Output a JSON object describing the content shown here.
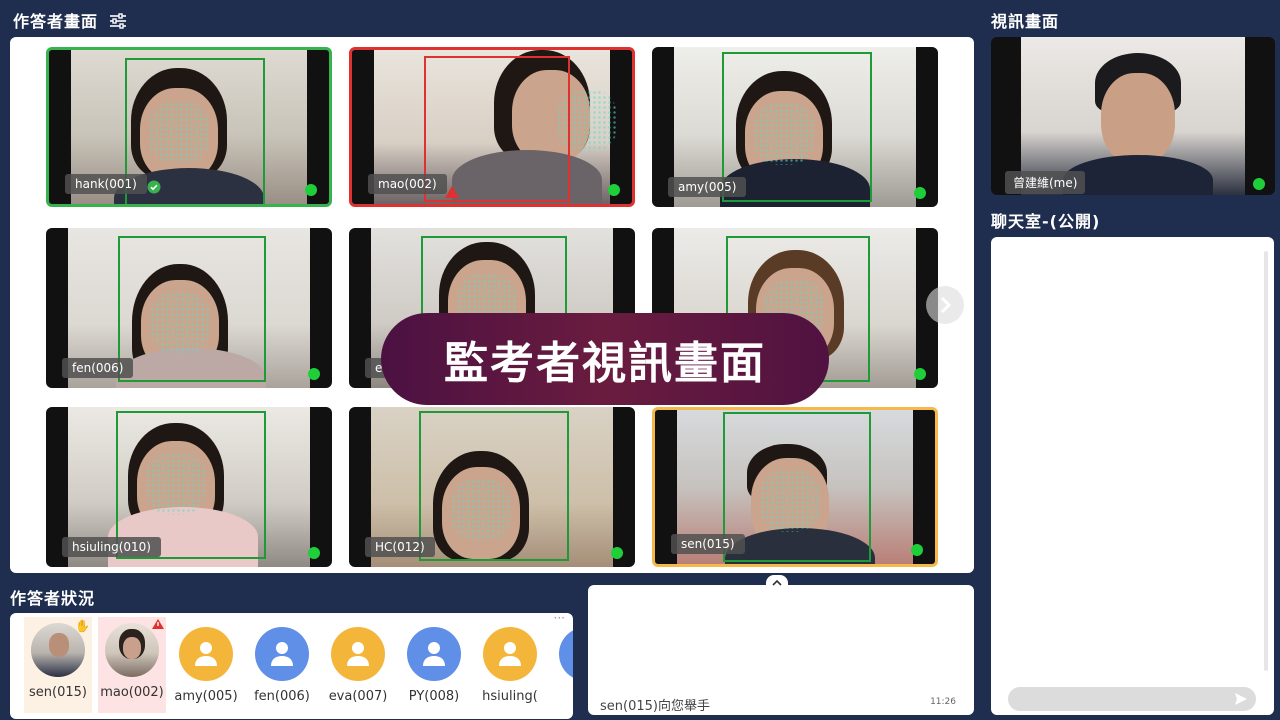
{
  "answerers_view": {
    "title": "作答者畫面",
    "filter_icon": "sliders-icon",
    "tiles": [
      {
        "name": "hank(001)",
        "status": "ok"
      },
      {
        "name": "mao(002)",
        "status": "alert"
      },
      {
        "name": "amy(005)",
        "status": "normal"
      },
      {
        "name": "fen(006)",
        "status": "normal"
      },
      {
        "name": "eva",
        "status": "normal"
      },
      {
        "name": "",
        "status": "normal"
      },
      {
        "name": "hsiuling(010)",
        "status": "normal"
      },
      {
        "name": "HC(012)",
        "status": "normal"
      },
      {
        "name": "sen(015)",
        "status": "raised-hand"
      }
    ],
    "next_icon": "chevron-right-icon"
  },
  "overlay_banner": "監考者視訊畫面",
  "video_view": {
    "title": "視訊畫面",
    "self_name": "曾建維(me)"
  },
  "chat": {
    "title": "聊天室-(公開)",
    "send_icon": "send-icon"
  },
  "status_strip": {
    "title": "作答者狀況",
    "candidates": [
      {
        "name": "sen(015)",
        "kind": "photo",
        "badge": "hand-icon"
      },
      {
        "name": "mao(002)",
        "kind": "photo",
        "badge": "warning-icon"
      },
      {
        "name": "amy(005)",
        "kind": "orange"
      },
      {
        "name": "fen(006)",
        "kind": "blue"
      },
      {
        "name": "eva(007)",
        "kind": "orange"
      },
      {
        "name": "PY(008)",
        "kind": "blue"
      },
      {
        "name": "hsiuling(",
        "kind": "orange"
      },
      {
        "name": "",
        "kind": "blue"
      }
    ],
    "more_icon": "ellipsis-icon"
  },
  "notifications": {
    "collapse_icon": "chevron-up-icon",
    "message": "sen(015)向您舉手",
    "time": "11:26"
  },
  "colors": {
    "background": "#1f2d4e",
    "ok": "#37b24d",
    "alert": "#e03131",
    "raised_hand": "#f5b84a",
    "online_dot": "#1fcf3a"
  }
}
